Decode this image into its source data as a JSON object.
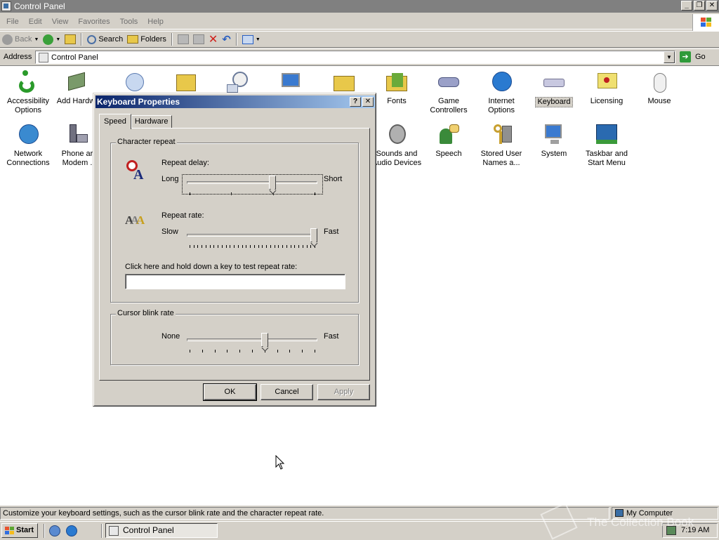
{
  "window": {
    "title": "Control Panel"
  },
  "menu": [
    "File",
    "Edit",
    "View",
    "Favorites",
    "Tools",
    "Help"
  ],
  "toolbar": {
    "back": "Back",
    "search": "Search",
    "folders": "Folders"
  },
  "address": {
    "label": "Address",
    "value": "Control Panel",
    "go": "Go"
  },
  "icons": [
    {
      "label": "Accessibility Options"
    },
    {
      "label": "Add Hardw"
    },
    {
      "label": ""
    },
    {
      "label": ""
    },
    {
      "label": ""
    },
    {
      "label": ""
    },
    {
      "label": ""
    },
    {
      "label": "Fonts"
    },
    {
      "label": "Game Controllers"
    },
    {
      "label": "Internet Options"
    },
    {
      "label": "Keyboard"
    },
    {
      "label": "Licensing"
    },
    {
      "label": "Mouse"
    },
    {
      "label": "Network Connections"
    },
    {
      "label": "Phone ar Modem ."
    },
    {
      "label": "Sounds and Audio Devices"
    },
    {
      "label": "Speech"
    },
    {
      "label": "Stored User Names a..."
    },
    {
      "label": "System"
    },
    {
      "label": "Taskbar and Start Menu"
    }
  ],
  "dialog": {
    "title": "Keyboard Properties",
    "help_btn": "?",
    "close_btn": "✕",
    "tabs": [
      "Speed",
      "Hardware"
    ],
    "char_repeat": {
      "legend": "Character repeat",
      "delay_label": "Repeat delay:",
      "delay_long": "Long",
      "delay_short": "Short",
      "delay_value": 0.667,
      "rate_label": "Repeat rate:",
      "rate_slow": "Slow",
      "rate_fast": "Fast",
      "rate_value": 1.0,
      "test_label": "Click here and hold down a key to test repeat rate:",
      "test_value": ""
    },
    "cursor_blink": {
      "legend": "Cursor blink rate",
      "none": "None",
      "fast": "Fast",
      "value": 0.6
    },
    "buttons": {
      "ok": "OK",
      "cancel": "Cancel",
      "apply": "Apply"
    }
  },
  "status": {
    "text": "Customize your keyboard settings, such as the cursor blink rate and the character repeat rate.",
    "zone": "My Computer"
  },
  "taskbar": {
    "start": "Start",
    "task": "Control Panel",
    "clock": "7:19 AM"
  },
  "watermark": "The Collection Book"
}
